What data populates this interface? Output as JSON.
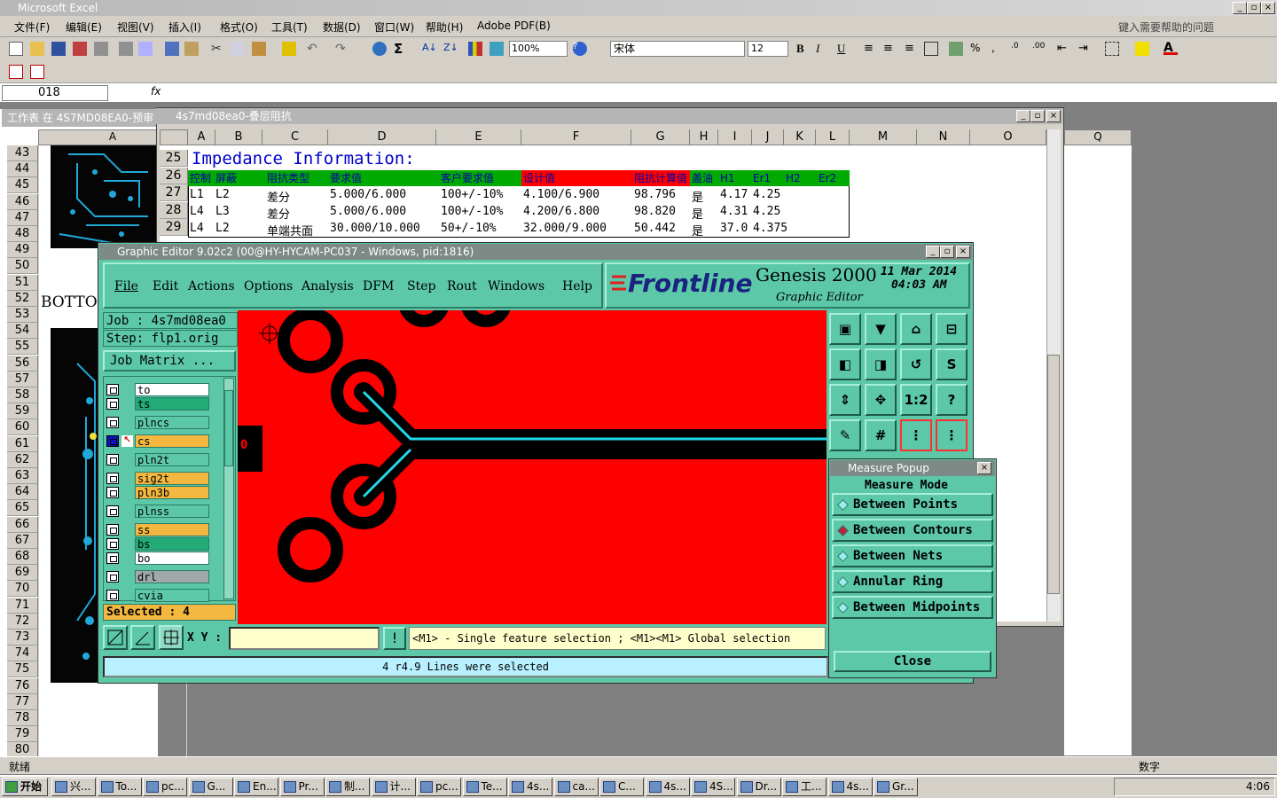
{
  "excel": {
    "title": "Microsoft Excel",
    "menu": [
      "文件(F)",
      "编辑(E)",
      "视图(V)",
      "插入(I)",
      "格式(O)",
      "工具(T)",
      "数据(D)",
      "窗口(W)",
      "帮助(H)",
      "Adobe PDF(B)"
    ],
    "help_placeholder": "键入需要帮助的问题",
    "zoom": "100%",
    "font_name": "宋体",
    "font_size": "12",
    "name_box": "018",
    "fx": "fx",
    "status_left": "就绪",
    "status_right": "数字"
  },
  "sheet_back": {
    "title": "工作表 在 4S7MD08EA0-预审",
    "col_a": "A",
    "col_q": "Q",
    "rows": [
      "43",
      "44",
      "45",
      "46",
      "47",
      "48",
      "49",
      "50",
      "51",
      "52",
      "53",
      "54",
      "55",
      "56",
      "57",
      "58",
      "59",
      "60",
      "61",
      "62",
      "63",
      "64",
      "65",
      "66",
      "67",
      "68",
      "69",
      "70",
      "71",
      "72",
      "73",
      "74",
      "75",
      "76",
      "77",
      "78",
      "79",
      "80"
    ],
    "bottom_label": "BOTTOM"
  },
  "impedance_window": {
    "title": "4s7md08ea0-叠层阻抗",
    "cols": [
      "A",
      "B",
      "C",
      "D",
      "E",
      "F",
      "G",
      "H",
      "I",
      "J",
      "K",
      "L",
      "M",
      "N",
      "O"
    ],
    "row_nums": [
      "25",
      "26",
      "27",
      "28",
      "29"
    ],
    "heading": "Impedance Information:",
    "headers": [
      "控制",
      "屏蔽",
      "阻抗类型",
      "要求值",
      "客户要求值",
      "设计值",
      "阻抗计算值",
      "盖油",
      "H1",
      "Er1",
      "H2",
      "Er2"
    ],
    "rows": [
      [
        "L1",
        "L2",
        "差分",
        "5.000/6.000",
        "100+/-10%",
        "4.100/6.900",
        "98.796",
        "是",
        "4.17",
        "4.25"
      ],
      [
        "L4",
        "L3",
        "差分",
        "5.000/6.000",
        "100+/-10%",
        "4.200/6.800",
        "98.820",
        "是",
        "4.31",
        "4.25"
      ],
      [
        "L4",
        "L2",
        "单端共面",
        "30.000/10.000",
        "50+/-10%",
        "32.000/9.000",
        "50.442",
        "是",
        "37.0",
        "4.375"
      ]
    ]
  },
  "graphic_editor": {
    "title": "Graphic Editor 9.02c2 (00@HY-HYCAM-PC037 - Windows, pid:1816)",
    "menu": [
      "File",
      "Edit",
      "Actions",
      "Options",
      "Analysis",
      "DFM",
      "Step",
      "Rout",
      "Windows",
      "Help"
    ],
    "logo": "Frontline",
    "product": "Genesis 2000",
    "subtitle": "Graphic Editor",
    "date": "11 Mar 2014",
    "time": "04:03 AM",
    "job": "Job : 4s7md08ea0",
    "step": "Step: flp1.orig",
    "job_matrix": "Job Matrix ...",
    "layers": [
      {
        "name": "to",
        "color": "#ffffff"
      },
      {
        "name": "ts",
        "color": "#22aa77"
      },
      {
        "name": "plncs",
        "color": "#5cc8a8"
      },
      {
        "name": "cs",
        "color": "#f4b840"
      },
      {
        "name": "pln2t",
        "color": "#5cc8a8"
      },
      {
        "name": "sig2t",
        "color": "#f4b840"
      },
      {
        "name": "pln3b",
        "color": "#f4b840"
      },
      {
        "name": "plnss",
        "color": "#5cc8a8"
      },
      {
        "name": "ss",
        "color": "#f4b840"
      },
      {
        "name": "bs",
        "color": "#22aa77"
      },
      {
        "name": "bo",
        "color": "#ffffff"
      },
      {
        "name": "drl",
        "color": "#a0a8a8"
      },
      {
        "name": "cvia",
        "color": "#5cc8a8"
      }
    ],
    "selected": "Selected : 4",
    "xy_label": "X Y :",
    "hint": "<M1> - Single feature selection ; <M1><M1> Global selection",
    "status": "4 r4.9 Lines were selected",
    "canvas_marker": "0"
  },
  "measure_popup": {
    "title": "Measure Popup",
    "mode_label": "Measure Mode",
    "options": [
      "Between Points",
      "Between Contours",
      "Between Nets",
      "Annular Ring",
      "Between Midpoints"
    ],
    "selected_option": "Between Contours",
    "close": "Close"
  },
  "taskbar": {
    "start": "开始",
    "items": [
      "兴...",
      "To...",
      "pc...",
      "G...",
      "En...",
      "Pr...",
      "制...",
      "计...",
      "pc...",
      "Te...",
      "4s...",
      "ca...",
      "C...",
      "4s...",
      "4S...",
      "Dr...",
      "工...",
      "4s...",
      "Gr..."
    ],
    "clock": "4:06"
  }
}
